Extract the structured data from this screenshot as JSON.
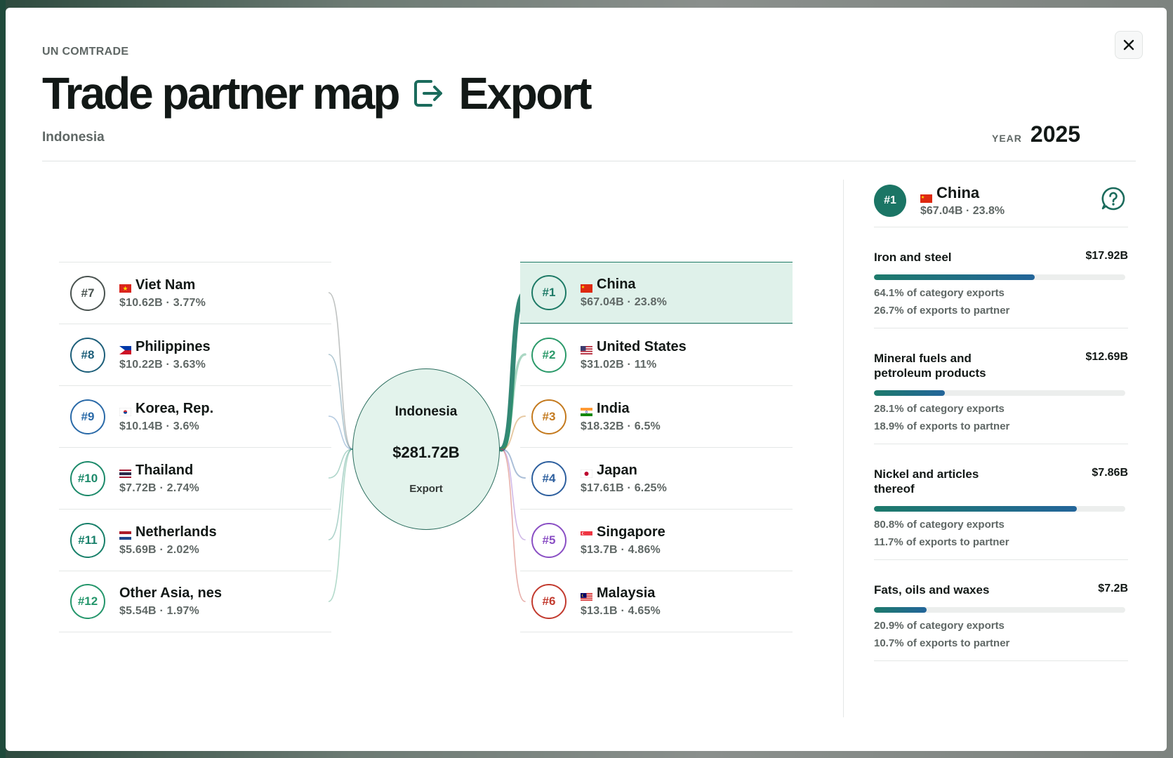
{
  "source": "UN COMTRADE",
  "title": "Trade partner map",
  "flow": "Export",
  "reporter": "Indonesia",
  "year_label": "YEAR",
  "year": "2025",
  "center": {
    "country": "Indonesia",
    "total": "$281.72B",
    "flow": "Export"
  },
  "left_partners": [
    {
      "rank": "#7",
      "name": "Viet Nam",
      "value": "$10.62B · 3.77%",
      "flag": "vn",
      "color": "#4a5350"
    },
    {
      "rank": "#8",
      "name": "Philippines",
      "value": "$10.22B · 3.63%",
      "flag": "ph",
      "color": "#1d5f7a"
    },
    {
      "rank": "#9",
      "name": "Korea, Rep.",
      "value": "$10.14B · 3.6%",
      "flag": "kr",
      "color": "#2a6aa8"
    },
    {
      "rank": "#10",
      "name": "Thailand",
      "value": "$7.72B · 2.74%",
      "flag": "th",
      "color": "#1c8a6a"
    },
    {
      "rank": "#11",
      "name": "Netherlands",
      "value": "$5.69B · 2.02%",
      "flag": "nl",
      "color": "#18806a"
    },
    {
      "rank": "#12",
      "name": "Other Asia, nes",
      "value": "$5.54B · 1.97%",
      "flag": "",
      "color": "#24966b"
    }
  ],
  "right_partners": [
    {
      "rank": "#1",
      "name": "China",
      "value": "$67.04B · 23.8%",
      "flag": "cn",
      "color": "#1d7a66",
      "active": true
    },
    {
      "rank": "#2",
      "name": "United States",
      "value": "$31.02B · 11%",
      "flag": "us",
      "color": "#2b9a6a"
    },
    {
      "rank": "#3",
      "name": "India",
      "value": "$18.32B · 6.5%",
      "flag": "in",
      "color": "#c47a1e"
    },
    {
      "rank": "#4",
      "name": "Japan",
      "value": "$17.61B · 6.25%",
      "flag": "jp",
      "color": "#2d5f9e"
    },
    {
      "rank": "#5",
      "name": "Singapore",
      "value": "$13.7B · 4.86%",
      "flag": "sg",
      "color": "#8a4fc4"
    },
    {
      "rank": "#6",
      "name": "Malaysia",
      "value": "$13.1B · 4.65%",
      "flag": "my",
      "color": "#c23a2e"
    }
  ],
  "detail": {
    "rank": "#1",
    "name": "China",
    "value": "$67.04B · 23.8%",
    "categories": [
      {
        "name": "Iron and steel",
        "value": "$17.92B",
        "share_fraction": 0.641,
        "stat1": "64.1% of category exports",
        "stat2": "26.7% of exports to partner"
      },
      {
        "name": "Mineral fuels and petroleum products",
        "value": "$12.69B",
        "share_fraction": 0.281,
        "stat1": "28.1% of category exports",
        "stat2": "18.9% of exports to partner"
      },
      {
        "name": "Nickel and articles thereof",
        "value": "$7.86B",
        "share_fraction": 0.808,
        "stat1": "80.8% of category exports",
        "stat2": "11.7% of exports to partner"
      },
      {
        "name": "Fats, oils and waxes",
        "value": "$7.2B",
        "share_fraction": 0.209,
        "stat1": "20.9% of category exports",
        "stat2": "10.7% of exports to partner"
      }
    ]
  },
  "icons": {
    "close": "close-icon",
    "export": "export-arrow-icon",
    "help": "help-chat-icon"
  }
}
